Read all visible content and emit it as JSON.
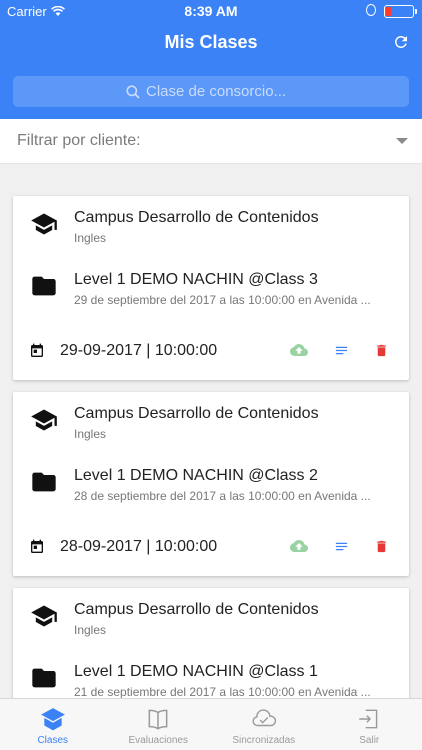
{
  "status_bar": {
    "carrier": "Carrier",
    "time": "8:39 AM"
  },
  "header": {
    "title": "Mis Clases"
  },
  "search": {
    "placeholder": "Clase de consorcio..."
  },
  "filter": {
    "label": "Filtrar por cliente:"
  },
  "classes": [
    {
      "campus": "Campus Desarrollo de Contenidos",
      "subject": "Ingles",
      "name": "Level 1 DEMO NACHIN @Class 3",
      "details": "29 de septiembre del 2017 a las 10:00:00 en Avenida ...",
      "datetime": "29-09-2017 | 10:00:00"
    },
    {
      "campus": "Campus Desarrollo de Contenidos",
      "subject": "Ingles",
      "name": "Level 1 DEMO NACHIN @Class 2",
      "details": "28 de septiembre del 2017 a las 10:00:00 en Avenida ...",
      "datetime": "28-09-2017 | 10:00:00"
    },
    {
      "campus": "Campus Desarrollo de Contenidos",
      "subject": "Ingles",
      "name": "Level 1 DEMO NACHIN @Class 1",
      "details": "21 de septiembre del 2017 a las 10:00:00 en Avenida ...",
      "datetime": ""
    }
  ],
  "tabs": [
    {
      "label": "Clases",
      "icon": "school-icon",
      "active": true
    },
    {
      "label": "Evaluaciones",
      "icon": "book-icon",
      "active": false
    },
    {
      "label": "Sincronizadas",
      "icon": "cloud-done-icon",
      "active": false
    },
    {
      "label": "Salir",
      "icon": "exit-icon",
      "active": false
    }
  ],
  "colors": {
    "primary": "#3b82f6",
    "upload_icon": "#9ad3a3",
    "details_icon": "#3b82f6",
    "delete_icon": "#e53935"
  }
}
